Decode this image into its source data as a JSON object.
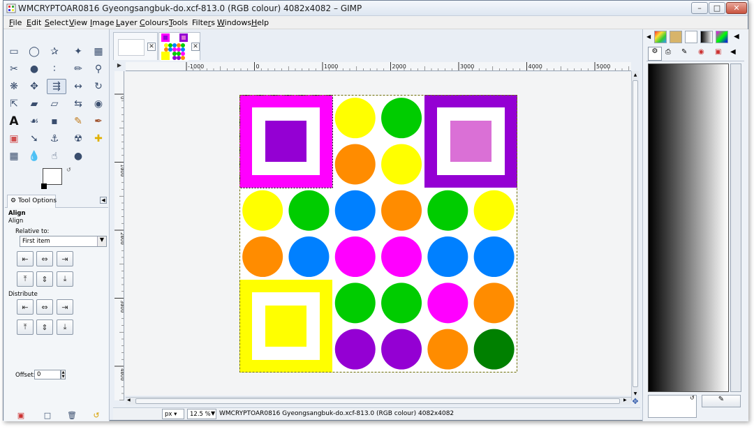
{
  "window": {
    "title": "WMCRYPTOAR0816 Gyeongsangbuk-do.xcf-813.0 (RGB colour) 4082x4082 – GIMP"
  },
  "menu": [
    {
      "label": "File",
      "key": "F"
    },
    {
      "label": "Edit",
      "key": "E"
    },
    {
      "label": "Select",
      "key": "S"
    },
    {
      "label": "View",
      "key": "V"
    },
    {
      "label": "Image",
      "key": "I"
    },
    {
      "label": "Layer",
      "key": "L"
    },
    {
      "label": "Colours",
      "key": "C"
    },
    {
      "label": "Tools",
      "key": "T"
    },
    {
      "label": "Filters",
      "key": "r"
    },
    {
      "label": "Windows",
      "key": "W"
    },
    {
      "label": "Help",
      "key": "H"
    }
  ],
  "tool_options": {
    "tab_label": "Tool Options",
    "header": "Align",
    "subheader": "Align",
    "relative_label": "Relative to:",
    "relative_value": "First item",
    "distribute_label": "Distribute",
    "offset_label": "Offset:",
    "offset_value": "0"
  },
  "ruler": {
    "h_labels": [
      "-1000",
      "0",
      "1000",
      "2000",
      "3000",
      "4000",
      "5000"
    ],
    "v_labels": [
      "0",
      "1000",
      "2000",
      "3000",
      "4000"
    ]
  },
  "statusbar": {
    "unit": "px",
    "zoom": "12.5 %",
    "info": "WMCRYPTOAR0816 Gyeongsangbuk-do.xcf-813.0 (RGB colour) 4082x4082"
  },
  "canvas": {
    "colors": {
      "magenta": "#ff00ff",
      "purple": "#9400d3",
      "orchid": "#da70d6",
      "yellow": "#ffff00",
      "green": "#00cc00",
      "blue": "#0080ff",
      "orange": "#ff8c00",
      "darkgreen": "#008000"
    },
    "squares": [
      {
        "pos": "top-left",
        "outer": "magenta",
        "inner": "purple"
      },
      {
        "pos": "top-right",
        "outer": "purple",
        "inner": "orchid"
      },
      {
        "pos": "bottom-left",
        "outer": "yellow",
        "inner": "yellow"
      }
    ],
    "circles": [
      {
        "row": 0,
        "col": 2,
        "color": "yellow"
      },
      {
        "row": 0,
        "col": 3,
        "color": "green"
      },
      {
        "row": 1,
        "col": 2,
        "color": "orange"
      },
      {
        "row": 1,
        "col": 3,
        "color": "yellow"
      },
      {
        "row": 2,
        "col": 0,
        "color": "yellow"
      },
      {
        "row": 2,
        "col": 1,
        "color": "green"
      },
      {
        "row": 2,
        "col": 2,
        "color": "blue"
      },
      {
        "row": 2,
        "col": 3,
        "color": "orange"
      },
      {
        "row": 2,
        "col": 4,
        "color": "green"
      },
      {
        "row": 2,
        "col": 5,
        "color": "yellow"
      },
      {
        "row": 3,
        "col": 0,
        "color": "orange"
      },
      {
        "row": 3,
        "col": 1,
        "color": "blue"
      },
      {
        "row": 3,
        "col": 2,
        "color": "magenta"
      },
      {
        "row": 3,
        "col": 3,
        "color": "magenta"
      },
      {
        "row": 3,
        "col": 4,
        "color": "blue"
      },
      {
        "row": 3,
        "col": 5,
        "color": "blue"
      },
      {
        "row": 4,
        "col": 2,
        "color": "green"
      },
      {
        "row": 4,
        "col": 3,
        "color": "green"
      },
      {
        "row": 4,
        "col": 4,
        "color": "magenta"
      },
      {
        "row": 4,
        "col": 5,
        "color": "orange"
      },
      {
        "row": 5,
        "col": 2,
        "color": "purple"
      },
      {
        "row": 5,
        "col": 3,
        "color": "purple"
      },
      {
        "row": 5,
        "col": 4,
        "color": "orange"
      },
      {
        "row": 5,
        "col": 5,
        "color": "darkgreen"
      }
    ]
  }
}
